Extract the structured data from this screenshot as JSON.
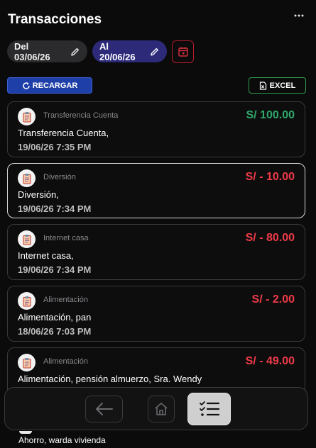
{
  "header": {
    "title": "Transacciones",
    "more_icon": "more-horizontal-icon"
  },
  "filters": {
    "date_from": "Del 03/06/26",
    "date_to": "Al 20/06/26",
    "edit_icon": "pencil-icon",
    "calendar_icon": "calendar-icon"
  },
  "actions": {
    "reload_label": "RECARGAR",
    "excel_label": "EXCEL"
  },
  "colors": {
    "positive": "#2fa869",
    "negative": "#ef3b47",
    "accent": "#2d2a7a"
  },
  "transactions": [
    {
      "category": "Transferencia Cuenta",
      "amount": "S/ 100.00",
      "type": "positive",
      "description": "Transferencia Cuenta,",
      "date": "19/06/26 7:35 PM"
    },
    {
      "category": "Diversión",
      "amount": "S/ - 10.00",
      "type": "negative",
      "description": "Diversión,",
      "date": "19/06/26 7:34 PM"
    },
    {
      "category": "Internet casa",
      "amount": "S/ - 80.00",
      "type": "negative",
      "description": "Internet casa,",
      "date": "19/06/26 7:34 PM"
    },
    {
      "category": "Alimentación",
      "amount": "S/ - 2.00",
      "type": "negative",
      "description": "Alimentación, pan",
      "date": "18/06/26 7:03 PM"
    },
    {
      "category": "Alimentación",
      "amount": "S/ - 49.00",
      "type": "negative",
      "description": "Alimentación, pensión almuerzo, Sra. Wendy",
      "date": ""
    }
  ],
  "partial_item": {
    "description": "Ahorro, warda vivienda"
  },
  "nav": {
    "back_icon": "arrow-left-icon",
    "home_icon": "home-icon",
    "list_icon": "checklist-icon"
  }
}
